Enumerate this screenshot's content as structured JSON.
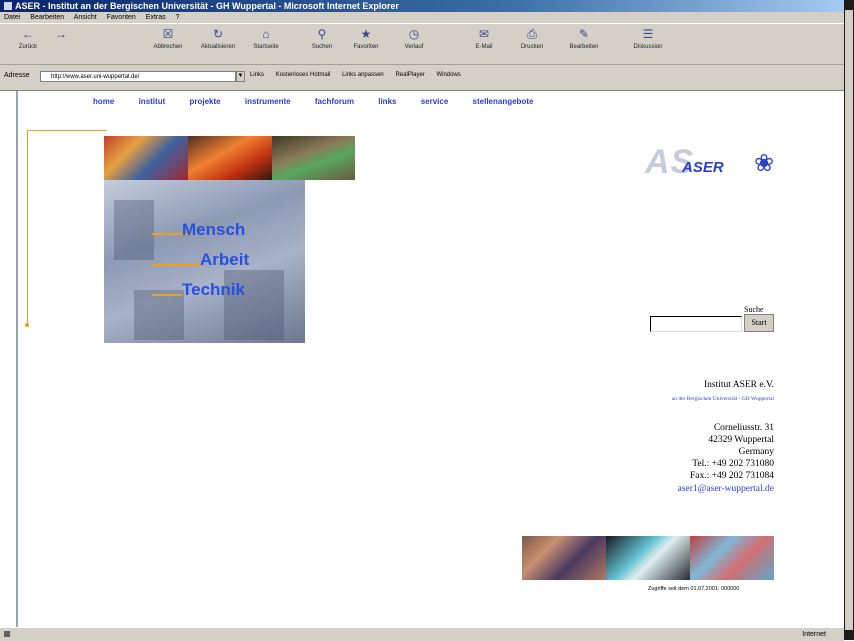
{
  "window": {
    "title": "ASER - Institut an der Bergischen Universität - GH Wuppertal - Microsoft Internet Explorer"
  },
  "menubar": [
    "Datei",
    "Bearbeiten",
    "Ansicht",
    "Favoriten",
    "Extras",
    "?"
  ],
  "toolbar": [
    {
      "label": "Zurück",
      "icon": "back-icon"
    },
    {
      "label": "",
      "icon": "forward-icon"
    },
    {
      "label": "Abbrechen",
      "icon": "stop-icon"
    },
    {
      "label": "Aktualisieren",
      "icon": "refresh-icon"
    },
    {
      "label": "Startseite",
      "icon": "home-icon"
    },
    {
      "label": "Suchen",
      "icon": "search-icon"
    },
    {
      "label": "Favoriten",
      "icon": "favorites-icon"
    },
    {
      "label": "Verlauf",
      "icon": "history-icon"
    },
    {
      "label": "E-Mail",
      "icon": "mail-icon"
    },
    {
      "label": "Drucken",
      "icon": "print-icon"
    },
    {
      "label": "Bearbeiten",
      "icon": "edit-icon"
    },
    {
      "label": "Diskussion",
      "icon": "discuss-icon"
    }
  ],
  "address": {
    "label": "Adresse",
    "url": "http://www.aser.uni-wuppertal.de/"
  },
  "links": [
    "Links",
    "Kostenloses Hotmail",
    "Links anpassen",
    "RealPlayer",
    "Windows"
  ],
  "nav": [
    "home",
    "institut",
    "projekte",
    "instrumente",
    "fachforum",
    "links",
    "service",
    "stellenangebote"
  ],
  "hero_words": [
    "Mensch",
    "Arbeit",
    "Technik"
  ],
  "logo": {
    "big": "AS",
    "small": "ASER"
  },
  "search": {
    "label": "Suche",
    "button": "Start"
  },
  "contact": {
    "name": "Institut ASER e.V.",
    "subtitle": "an der Bergischen Universität - GH Wuppertal",
    "street": "Corneliusstr. 31",
    "city": "42329 Wuppertal",
    "country": "Germany",
    "tel": "Tel.: +49 202 731080",
    "fax": "Fax.: +49 202 731084",
    "email": "aser1@aser-wuppertal.de"
  },
  "counter": "Zugriffe seit dem 01.07.2001: 000000",
  "status": {
    "zone": "Internet"
  }
}
